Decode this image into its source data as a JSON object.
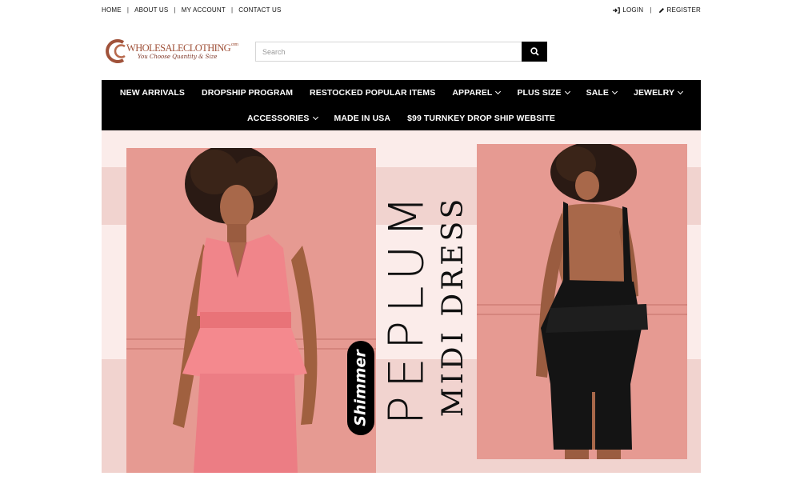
{
  "topbar": {
    "links": [
      "HOME",
      "ABOUT US",
      "MY ACCOUNT",
      "CONTACT US"
    ],
    "separator": "|",
    "login": "LOGIN",
    "register": "REGISTER",
    "login_icon": "sign-in-icon",
    "register_icon": "pencil-icon"
  },
  "logo": {
    "brand": "WHOLESALECLOTHING",
    "brand_suffix": ".com",
    "tagline": "You Choose Quantity & Size",
    "brand_color": "#a0523a"
  },
  "search": {
    "placeholder": "Search",
    "value": "",
    "button_icon": "search-icon"
  },
  "nav": {
    "row1": [
      {
        "label": "NEW ARRIVALS",
        "dropdown": false
      },
      {
        "label": "DROPSHIP PROGRAM",
        "dropdown": false
      },
      {
        "label": "RESTOCKED POPULAR ITEMS",
        "dropdown": false
      },
      {
        "label": "APPAREL",
        "dropdown": true
      },
      {
        "label": "PLUS SIZE",
        "dropdown": true
      },
      {
        "label": "SALE",
        "dropdown": true
      },
      {
        "label": "JEWELRY",
        "dropdown": true
      }
    ],
    "row2": [
      {
        "label": "ACCESSORIES",
        "dropdown": true
      },
      {
        "label": "MADE IN USA",
        "dropdown": false
      },
      {
        "label": "$99 TURNKEY DROP SHIP WEBSITE",
        "dropdown": false
      }
    ]
  },
  "banner": {
    "headline": "PEPLUM",
    "subheadline": "MIDI DRESS",
    "badge": "Shimmer",
    "colors": {
      "background": "#fbecea",
      "band": "#f1d3cf",
      "photo_wall": "#e69a92",
      "pink_dress": "#f0858a",
      "black_dress": "#141414"
    }
  }
}
